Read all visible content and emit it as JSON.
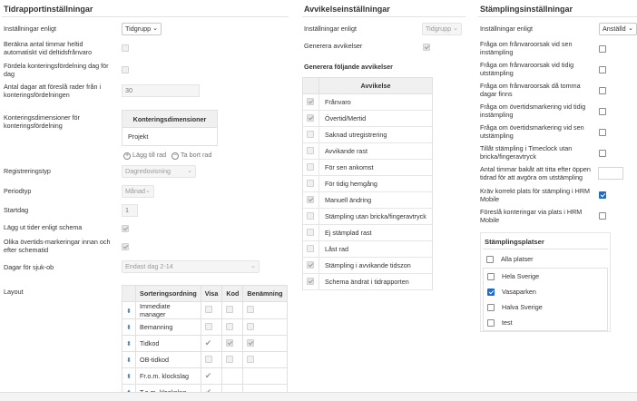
{
  "tid": {
    "title": "Tidrapportinställningar",
    "installningar_label": "Inställningar enligt",
    "installningar_value": "Tidgrupp",
    "berakna_label": "Beräkna antal timmar heltid automatiskt vid deltidsfrånvaro",
    "fordela_label": "Fördela konteringsfördelning dag för dag",
    "antal_label": "Antal dagar att föreslå rader från i konteringsfördelningen",
    "antal_value": "30",
    "kontdim_label": "Konteringsdimensioner för konteringsfördelning",
    "kontdim_header": "Konteringsdimensioner",
    "kontdim_row": "Projekt",
    "add_row": "Lägg till rad",
    "remove_row": "Ta bort rad",
    "regtyp_label": "Registreringstyp",
    "regtyp_value": "Dagredovisning",
    "periodtyp_label": "Periodtyp",
    "periodtyp_value": "Månad",
    "startdag_label": "Startdag",
    "startdag_value": "1",
    "laggut_label": "Lägg ut tider enligt schema",
    "olika_label": "Olika övertids-markeringar innan och efter schematid",
    "dagar_label": "Dagar för sjuk-ob",
    "dagar_value": "Endast dag 2-14",
    "layout_label": "Layout",
    "layout_headers": [
      "Sorteringsordning",
      "Visa",
      "Kod",
      "Benämning"
    ],
    "layout_rows": [
      {
        "name": "Immediate manager"
      },
      {
        "name": "Bemanning"
      },
      {
        "name": "Tidkod"
      },
      {
        "name": "OB-tidkod"
      },
      {
        "name": "Fr.o.m. klockslag"
      },
      {
        "name": "T.o.m. klockslag"
      }
    ]
  },
  "avv": {
    "title": "Avvikelseinställningar",
    "installningar_label": "Inställningar enligt",
    "installningar_value": "Tidgrupp",
    "generera_label": "Generera avvikelser",
    "generera_foljande": "Generera följande avvikelser",
    "col_header": "Avvikelse",
    "items": [
      "Frånvaro",
      "Övertid/Mertid",
      "Saknad utregistrering",
      "Avvikande rast",
      "För sen ankomst",
      "För tidig hemgång",
      "Manuell ändring",
      "Stämpling utan bricka/fingeravtryck",
      "Ej stämplad rast",
      "Låst rad",
      "Stämpling i avvikande tidszon",
      "Schema ändrat i tidrapporten"
    ]
  },
  "stamp": {
    "title": "Stämplingsinställningar",
    "installningar_label": "Inställningar enligt",
    "installningar_value": "Anställd",
    "q1": "Fråga om frånvaroorsak vid sen instämpling",
    "q2": "Fråga om frånvaroorsak vid tidig utstämpling",
    "q3": "Fråga om frånvaroorsak då tomma dagar finns",
    "q4": "Fråga om övertidsmarkering vid tidig instämpling",
    "q5": "Fråga om övertidsmarkering vid sen utstämpling",
    "q6": "Tillåt stämpling i Timeclock utan bricka/fingeravtryck",
    "q7": "Antal timmar bakåt att titta efter öppen tidrad för att avgöra om utstämpling",
    "q8": "Kräv korrekt plats för stämpling i HRM Mobile",
    "q9": "Föreslå konteringar via plats i HRM Mobile",
    "platser_title": "Stämplingsplatser",
    "alla": "Alla platser",
    "platser": [
      "Hela Sverige",
      "Vasaparken",
      "Halva Sverige",
      "test"
    ]
  }
}
